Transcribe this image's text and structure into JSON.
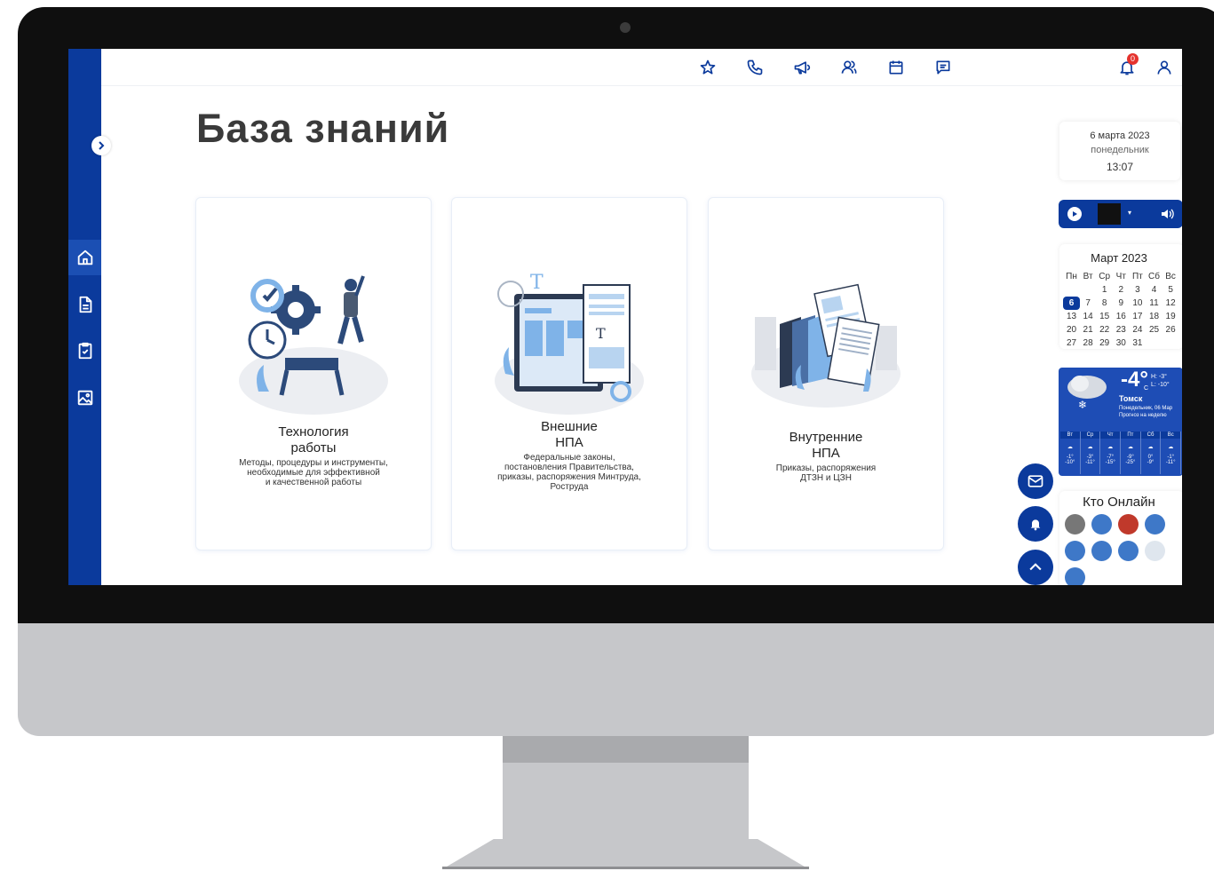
{
  "page": {
    "title": "База знаний"
  },
  "cards": [
    {
      "title": "Технология\nработы",
      "description": "Методы, процедуры и инструменты,\nнеобходимые для эффективной\nи качественной работы"
    },
    {
      "title": "Внешние\nНПА",
      "description": "Федеральные законы,\nпостановления Правительства,\nприказы, распоряжения Минтруда,\nРоструда"
    },
    {
      "title": "Внутренние\nНПА",
      "description": "Приказы, распоряжения\nДТЗН и ЦЗН"
    }
  ],
  "topbar": {
    "icons": [
      "star-icon",
      "phone-icon",
      "megaphone-icon",
      "users-icon",
      "calendar-icon",
      "chat-icon"
    ],
    "notification_count": "0"
  },
  "sidebar": {
    "items": [
      "home-icon",
      "document-icon",
      "clipboard-check-icon",
      "image-icon"
    ],
    "active_index": 0
  },
  "date_widget": {
    "date": "6 марта 2023",
    "weekday": "понедельник",
    "time": "13:07"
  },
  "calendar": {
    "title": "Март 2023",
    "weekdays": [
      "Пн",
      "Вт",
      "Ср",
      "Чт",
      "Пт",
      "Сб",
      "Вс"
    ],
    "weeks": [
      [
        "",
        "",
        "1",
        "2",
        "3",
        "4",
        "5"
      ],
      [
        "6",
        "7",
        "8",
        "9",
        "10",
        "11",
        "12"
      ],
      [
        "13",
        "14",
        "15",
        "16",
        "17",
        "18",
        "19"
      ],
      [
        "20",
        "21",
        "22",
        "23",
        "24",
        "25",
        "26"
      ],
      [
        "27",
        "28",
        "29",
        "30",
        "31",
        "",
        ""
      ]
    ],
    "today": "6"
  },
  "weather": {
    "temp": "-4°",
    "unit": "C",
    "high": "H: -3°",
    "low": "L: -10°",
    "city": "Томск",
    "date": "Понедельник, 06 Мар",
    "forecast_label": "Прогноз на неделю",
    "days": [
      {
        "day": "Вт",
        "hi": "-1°",
        "lo": "-10°"
      },
      {
        "day": "Ср",
        "hi": "-3°",
        "lo": "-11°"
      },
      {
        "day": "Чт",
        "hi": "-7°",
        "lo": "-15°"
      },
      {
        "day": "Пт",
        "hi": "-9°",
        "lo": "-25°"
      },
      {
        "day": "Сб",
        "hi": "0°",
        "lo": "-9°"
      },
      {
        "day": "Вс",
        "hi": "-1°",
        "lo": "-11°"
      }
    ]
  },
  "online": {
    "title": "Кто Онлайн"
  },
  "colors": {
    "primary": "#0b3a9c",
    "accent": "#4aa3e8",
    "badge": "#e5322d"
  }
}
